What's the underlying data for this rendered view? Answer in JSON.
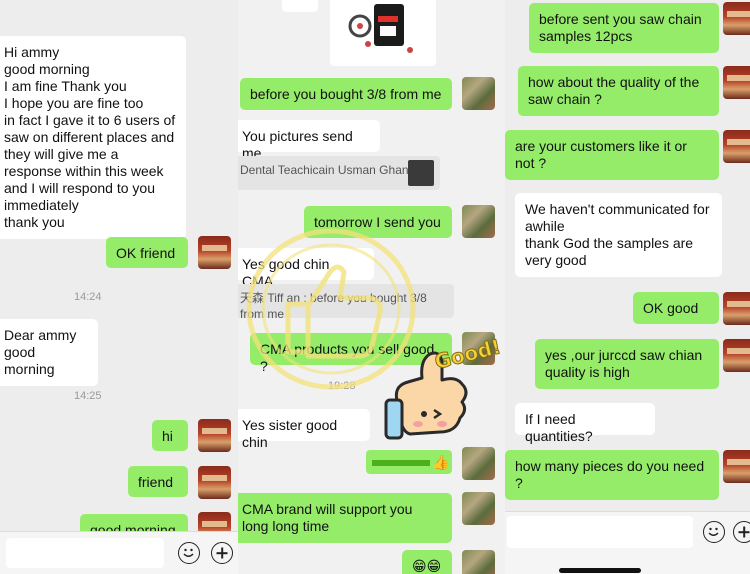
{
  "panel1": {
    "msg_hi": "Hi ammy\ngood morning\nI am fine Thank you\nI hope you are fine too\nin fact I gave it to 6 users of saw on different places  and they will give me a response within this week and I will respond to you immediately\nthank you",
    "reply_ok_friend": "OK friend",
    "time_1": "14:24",
    "msg_dear": "Dear ammy\ngood morning",
    "time_2": "14:25",
    "reply_hi": "hi",
    "reply_friend": "friend",
    "reply_good_morning": "good morning"
  },
  "panel2": {
    "msg_before_bought": "before you bought 3/8 from me",
    "msg_pictures": "You pictures send me",
    "quote_1": "Dental Teachicain Usman Ghani :",
    "msg_tomorrow": "tomorrow I send you",
    "msg_yes_good": "Yes good chin CMA",
    "quote_2": "天森 Tiff an : before you bought 3/8 from me",
    "msg_cma_products": "CMA products you sell good ?",
    "time_1": "19:28",
    "msg_yes_sister": "Yes sister good chin",
    "msg_cma_brand": "CMA brand will support you long long time",
    "sticker_text": "Good!",
    "emoji_reply": "😁😁"
  },
  "panel3": {
    "msg_before_sent": "before sent you saw chain samples 12pcs",
    "msg_quality": "how about the quality of the saw chain ?",
    "msg_customers": "are your customers like it or not ?",
    "reply_not_communicated": "We haven't communicated for awhile\nthank God the samples are very good",
    "msg_ok_good": "OK  good",
    "msg_yes_our": "yes ,our jurccd saw chian quality is high",
    "reply_if_need": "If I need quantities?",
    "msg_how_many": "how many pieces do you need ?"
  },
  "colors": {
    "outgoing": "#95ec69",
    "incoming": "#ffffff",
    "background": "#ededed"
  },
  "icons": [
    "emoji-icon",
    "plus-icon",
    "thumbs-up-sticker",
    "good-sticker"
  ]
}
